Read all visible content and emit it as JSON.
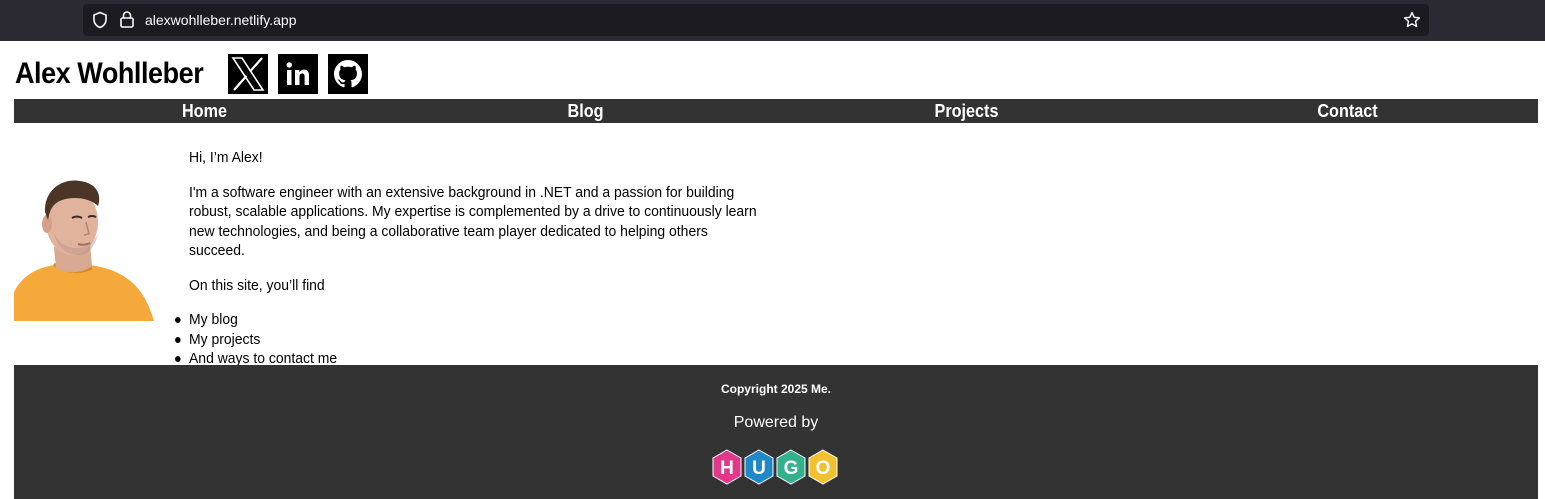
{
  "browser": {
    "url": "alexwohlleber.netlify.app"
  },
  "header": {
    "title": "Alex Wohlleber",
    "social": [
      {
        "name": "x",
        "icon": "x-logo-icon"
      },
      {
        "name": "linkedin",
        "icon": "linkedin-icon"
      },
      {
        "name": "github",
        "icon": "github-icon"
      }
    ]
  },
  "nav": {
    "items": [
      "Home",
      "Blog",
      "Projects",
      "Contact"
    ]
  },
  "main": {
    "greeting": "Hi, I’m Alex!",
    "intro": "I'm a software engineer with an extensive background in .NET and a passion for building robust, scalable applications. My expertise is complemented by a drive to continuously learn new technologies, and being a collaborative team player dedicated to helping others succeed.",
    "find_intro": "On this site, you’ll find",
    "list": [
      "My blog",
      "My projects",
      "And ways to contact me"
    ]
  },
  "footer": {
    "copyright": "Copyright 2025 Me.",
    "powered_by": "Powered by",
    "hugo_letters": [
      "H",
      "U",
      "G",
      "O"
    ]
  },
  "colors": {
    "nav_bg": "#333333",
    "hugo_h": "#e0388b",
    "hugo_u": "#1e88c8",
    "hugo_g": "#33b18f",
    "hugo_o": "#f2c12e"
  }
}
